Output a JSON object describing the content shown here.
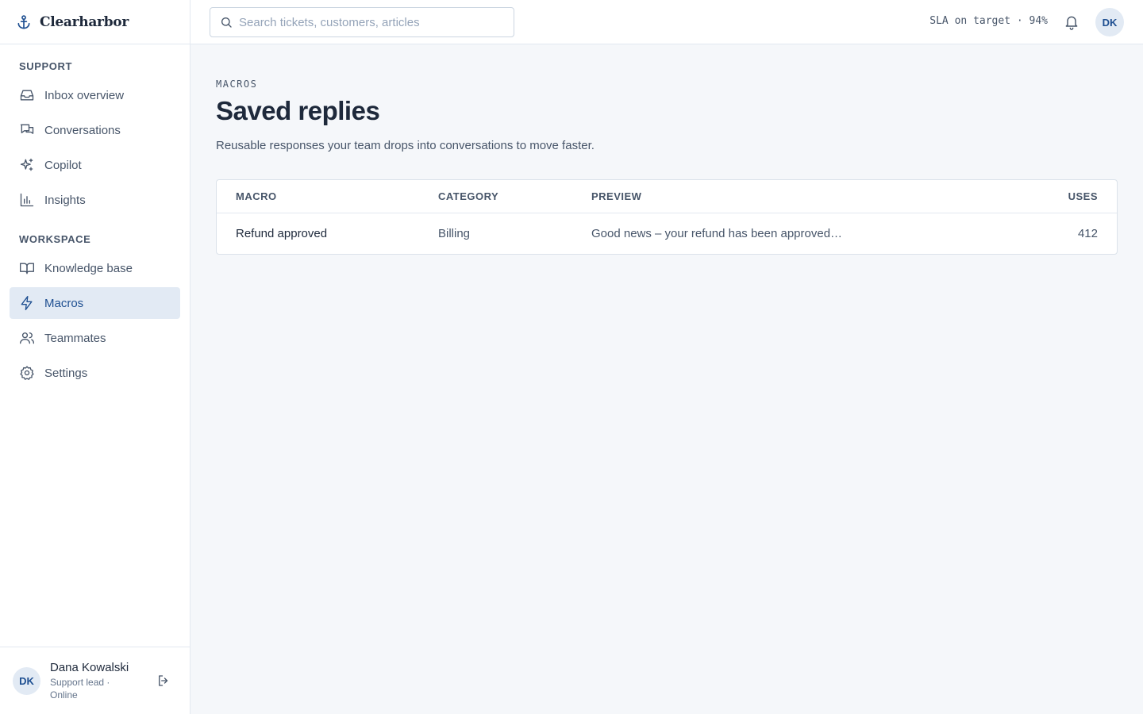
{
  "brand": {
    "name": "Clearharbor"
  },
  "sidebar": {
    "sections": [
      {
        "heading": "SUPPORT",
        "items": [
          {
            "label": "Inbox overview",
            "icon": "inbox-icon"
          },
          {
            "label": "Conversations",
            "icon": "chat-icon"
          },
          {
            "label": "Copilot",
            "icon": "sparkle-icon"
          },
          {
            "label": "Insights",
            "icon": "bar-chart-icon"
          }
        ]
      },
      {
        "heading": "WORKSPACE",
        "items": [
          {
            "label": "Knowledge base",
            "icon": "book-icon"
          },
          {
            "label": "Macros",
            "icon": "lightning-icon",
            "active": true
          },
          {
            "label": "Teammates",
            "icon": "users-icon"
          },
          {
            "label": "Settings",
            "icon": "gear-icon"
          }
        ]
      }
    ],
    "user": {
      "initials": "DK",
      "name": "Dana Kowalski",
      "role": "Support lead · Online"
    }
  },
  "topbar": {
    "search_placeholder": "Search tickets, customers, articles",
    "sla_status": "SLA on target · 94%",
    "avatar_initials": "DK"
  },
  "page": {
    "eyebrow": "MACROS",
    "title": "Saved replies",
    "subtitle": "Reusable responses your team drops into conversations to move faster."
  },
  "table": {
    "columns": [
      "MACRO",
      "CATEGORY",
      "PREVIEW",
      "USES"
    ],
    "rows": [
      {
        "macro": "Refund approved",
        "category": "Billing",
        "preview": "Good news – your refund has been approved…",
        "uses": "412"
      }
    ]
  },
  "colors": {
    "accent": "#1e4f91",
    "active_bg": "#e2eaf4",
    "page_bg": "#f5f7fa"
  }
}
